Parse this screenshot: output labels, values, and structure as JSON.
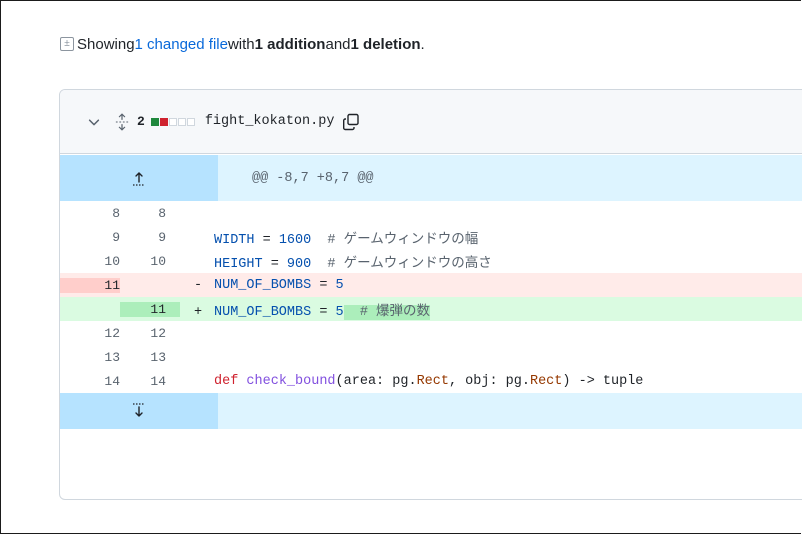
{
  "summary": {
    "prefix": "Showing ",
    "changed_link": "1 changed file",
    "with": " with ",
    "additions": "1 addition",
    "and": " and ",
    "deletions": "1 deletion",
    "suffix": "."
  },
  "file": {
    "change_count": "2",
    "filename": "fight_kokaton.py",
    "diffstat": [
      "add",
      "del",
      "neu",
      "neu",
      "neu"
    ]
  },
  "hunk_header": "@@ -8,7 +8,7 @@",
  "lines": {
    "l8": {
      "old": "8",
      "new": "8"
    },
    "l9": {
      "old": "9",
      "new": "9",
      "ident": "WIDTH",
      "eq": " = ",
      "value": "1600",
      "comment": "  # ゲームウィンドウの幅"
    },
    "l10": {
      "old": "10",
      "new": "10",
      "ident": "HEIGHT",
      "eq": " = ",
      "value": "900",
      "comment": "  # ゲームウィンドウの高さ"
    },
    "del": {
      "old": "11",
      "sign": "-",
      "ident": "NUM_OF_BOMBS",
      "eq": " = ",
      "value": "5"
    },
    "add": {
      "new": "11",
      "sign": "+",
      "ident": "NUM_OF_BOMBS",
      "eq": " = ",
      "value": "5",
      "comment": "  # 爆弾の数"
    },
    "l12": {
      "old": "12",
      "new": "12"
    },
    "l13": {
      "old": "13",
      "new": "13"
    },
    "l14": {
      "old": "14",
      "new": "14",
      "kw": "def",
      "fn": "check_bound",
      "p1": "(area: pg.",
      "t1": "Rect",
      "p2": ", obj: pg.",
      "t2": "Rect",
      "p3": ") -> tuple"
    }
  },
  "colors": {
    "link": "#0969da",
    "hunk_bg": "#ddf4ff",
    "hunk_gutter": "#b6e3ff",
    "del_bg": "#ffebe9",
    "add_bg": "#dafbe1",
    "add_highlight": "#aceebb"
  },
  "icons": {
    "summary": "diff-icon",
    "collapse": "chevron-down-icon",
    "expand": "expand-all-icon",
    "copy": "copy-icon",
    "expand_up": "expand-up-icon",
    "expand_down": "expand-down-icon"
  }
}
